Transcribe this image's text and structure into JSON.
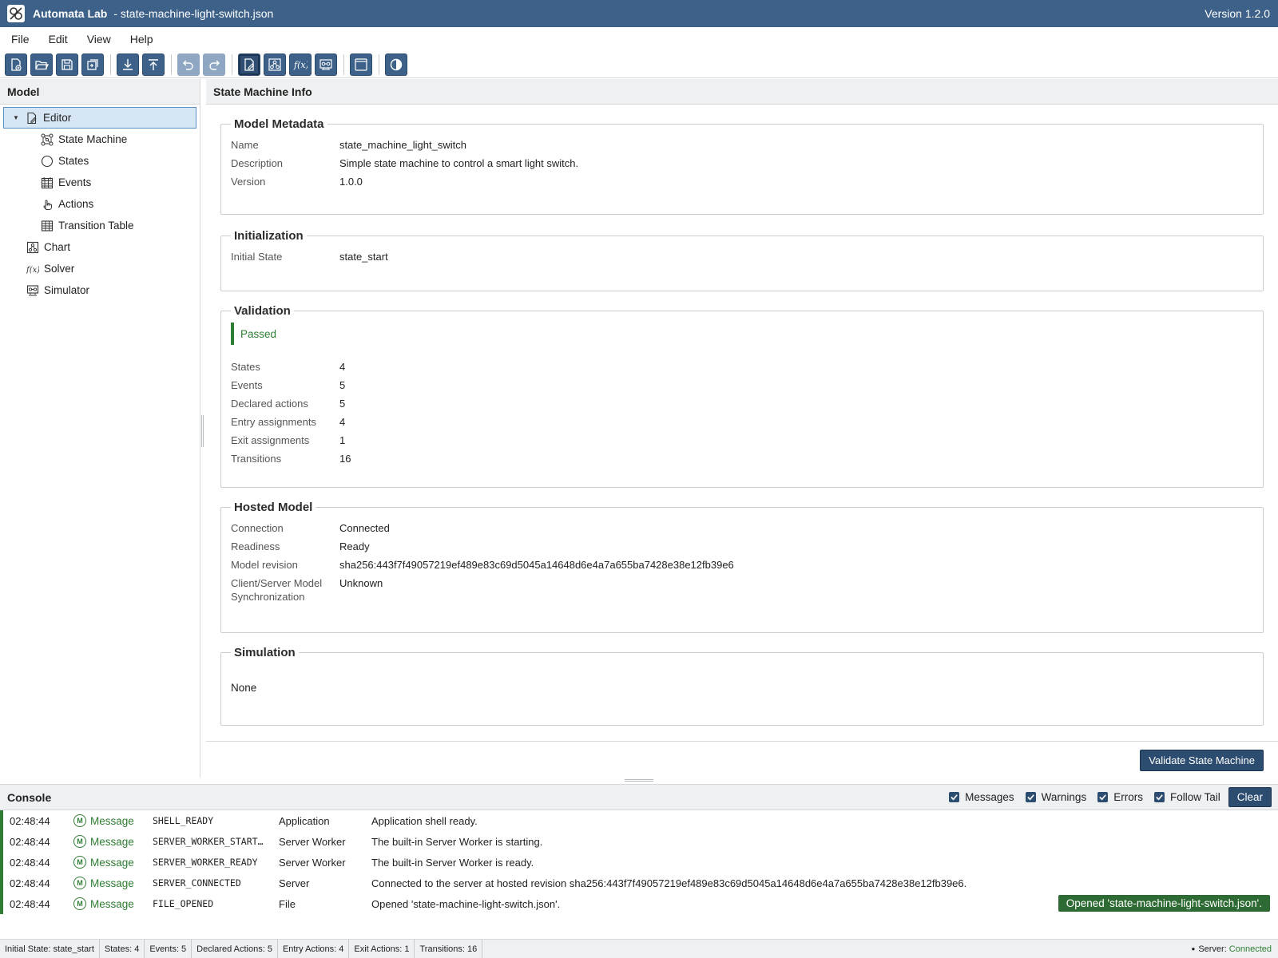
{
  "titlebar": {
    "app_name": "Automata Lab",
    "file_name": "- state-machine-light-switch.json",
    "version": "Version 1.2.0"
  },
  "menu": [
    "File",
    "Edit",
    "View",
    "Help"
  ],
  "toolbar": {
    "icons": [
      "new-file-icon",
      "open-folder-icon",
      "save-icon",
      "save-as-icon",
      "import-icon",
      "export-icon",
      "undo-icon",
      "redo-icon",
      "editor-icon",
      "chart-icon",
      "solver-icon",
      "simulator-icon",
      "layout-icon",
      "theme-toggle-icon"
    ]
  },
  "left_panel": {
    "title": "Model",
    "tree": [
      {
        "label": "Editor",
        "icon": "editor-icon",
        "selected": true
      },
      {
        "label": "State Machine",
        "icon": "state-machine-icon"
      },
      {
        "label": "States",
        "icon": "circle-icon"
      },
      {
        "label": "Events",
        "icon": "calendar-icon"
      },
      {
        "label": "Actions",
        "icon": "hand-pointer-icon"
      },
      {
        "label": "Transition Table",
        "icon": "table-icon"
      },
      {
        "label": "Chart",
        "icon": "chart-icon"
      },
      {
        "label": "Solver",
        "icon": "function-icon"
      },
      {
        "label": "Simulator",
        "icon": "simulator-icon"
      }
    ]
  },
  "main": {
    "title": "State Machine Info",
    "metadata": {
      "legend": "Model Metadata",
      "rows": [
        {
          "k": "Name",
          "v": "state_machine_light_switch"
        },
        {
          "k": "Description",
          "v": "Simple state machine to control a smart light switch."
        },
        {
          "k": "Version",
          "v": "1.0.0"
        }
      ]
    },
    "initialization": {
      "legend": "Initialization",
      "rows": [
        {
          "k": "Initial State",
          "v": "state_start"
        }
      ]
    },
    "validation": {
      "legend": "Validation",
      "status": "Passed",
      "rows": [
        {
          "k": "States",
          "v": "4"
        },
        {
          "k": "Events",
          "v": "5"
        },
        {
          "k": "Declared actions",
          "v": "5"
        },
        {
          "k": "Entry assignments",
          "v": "4"
        },
        {
          "k": "Exit assignments",
          "v": "1"
        },
        {
          "k": "Transitions",
          "v": "16"
        }
      ]
    },
    "hosted": {
      "legend": "Hosted Model",
      "rows": [
        {
          "k": "Connection",
          "v": "Connected"
        },
        {
          "k": "Readiness",
          "v": "Ready"
        },
        {
          "k": "Model revision",
          "v": "sha256:443f7f49057219ef489e83c69d5045a14648d6e4a7a655ba7428e38e12fb39e6"
        }
      ],
      "sync_label_1": "Client/Server Model",
      "sync_label_2": "Synchronization",
      "sync_value": "Unknown"
    },
    "simulation": {
      "legend": "Simulation",
      "value": "None"
    },
    "validate_button": "Validate State Machine"
  },
  "console": {
    "title": "Console",
    "filters": [
      "Messages",
      "Warnings",
      "Errors",
      "Follow Tail"
    ],
    "clear_label": "Clear",
    "rows": [
      {
        "time": "02:48:44",
        "level": "Message",
        "code": "SHELL_READY",
        "source": "Application",
        "message": "Application shell ready."
      },
      {
        "time": "02:48:44",
        "level": "Message",
        "code": "SERVER_WORKER_START…",
        "source": "Server Worker",
        "message": "The built-in Server Worker is starting."
      },
      {
        "time": "02:48:44",
        "level": "Message",
        "code": "SERVER_WORKER_READY",
        "source": "Server Worker",
        "message": "The built-in Server Worker is ready."
      },
      {
        "time": "02:48:44",
        "level": "Message",
        "code": "SERVER_CONNECTED",
        "source": "Server",
        "message": "Connected to the server at hosted revision sha256:443f7f49057219ef489e83c69d5045a14648d6e4a7a655ba7428e38e12fb39e6."
      },
      {
        "time": "02:48:44",
        "level": "Message",
        "code": "FILE_OPENED",
        "source": "File",
        "message": "Opened 'state-machine-light-switch.json'."
      }
    ],
    "toast": "Opened 'state-machine-light-switch.json'."
  },
  "statusbar": {
    "items": [
      "Initial State: state_start",
      "States: 4",
      "Events: 5",
      "Declared Actions: 5",
      "Entry Actions: 4",
      "Exit Actions: 1",
      "Transitions: 16"
    ],
    "server_label": "Server:",
    "server_status": "Connected"
  },
  "colors": {
    "accent": "#3d6189",
    "success": "#2e7d32"
  }
}
